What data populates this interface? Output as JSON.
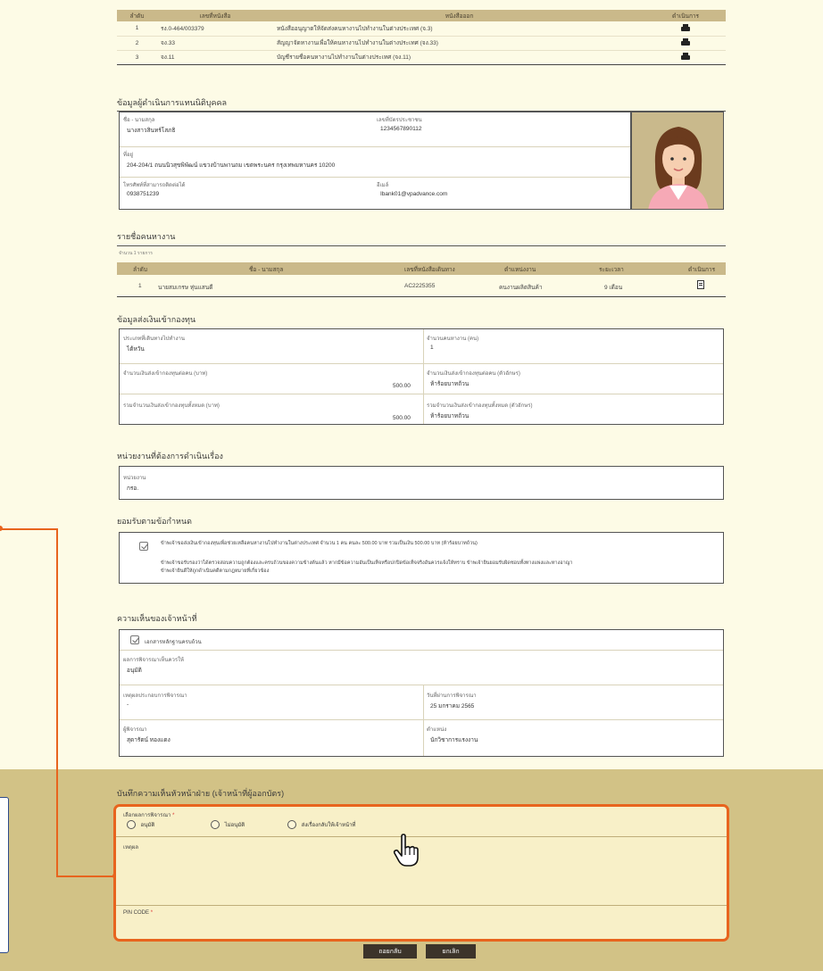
{
  "doc_table": {
    "headers": [
      "ลำดับ",
      "เลขที่หนังสือ",
      "หนังสือออก",
      "ดำเนินการ"
    ],
    "rows": [
      {
        "no": "1",
        "doc_no": "รง.0-464/003379",
        "title": "หนังสืออนุญาตให้จัดส่งคนหางานไปทำงานในต่างประเทศ (จ.3)"
      },
      {
        "no": "2",
        "doc_no": "จง.33",
        "title": "สัญญาจัดหางานเพื่อให้คนหางานไปทำงานในต่างประเทศ (จง.33)"
      },
      {
        "no": "3",
        "doc_no": "จง.11",
        "title": "บัญชีรายชื่อคนหางานไปทำงานในต่างประเทศ (จง.11)"
      }
    ]
  },
  "operator": {
    "section_title": "ข้อมูลผู้ดำเนินการแทนนิติบุคคล",
    "name_label": "ชื่อ - นามสกุล",
    "name_value": "นางสาวสินทร์โสภธิ",
    "id_label": "เลขที่บัตรประชาชน",
    "id_value": "1234567890112",
    "address_label": "ที่อยู่",
    "address_value": "204-204/1 ถนนนิวสุขพิพัฒน์ แขวงบ้านพานถม เขตพระนคร กรุงเทพมหานคร 10200",
    "phone_label": "โทรศัพท์ที่สามารถติดต่อได้",
    "phone_value": "0938751239",
    "email_label": "อีเมล์",
    "email_value": "Ibank01@vpadvance.com"
  },
  "workers": {
    "section_title": "รายชื่อคนหางาน",
    "count_text": "จำนวน 1 รายการ",
    "headers": [
      "ลำดับ",
      "ชื่อ - นามสกุล",
      "เลขที่หนังสือเดินทาง",
      "ตำแหน่งงาน",
      "ระยะเวลา",
      "ดำเนินการ"
    ],
    "rows": [
      {
        "no": "1",
        "name": "นายสมเกรษ หุ่นแสนดี",
        "passport": "AC2225355",
        "position": "คนงานผลิตสินค้า",
        "duration": "9 เดือน"
      }
    ]
  },
  "fund": {
    "section_title": "ข้อมูลส่งเงินเข้ากองทุน",
    "type_label": "ประเภทที่เดินทางไปทำงาน",
    "type_value": "ไต้หวัน",
    "workers_count_label": "จำนวนคนหางาน (คน)",
    "workers_count_value": "1",
    "per_person_label": "จำนวนเงินส่งเข้ากองทุนต่อคน (บาท)",
    "per_person_value": "500.00",
    "per_person_text_label": "จำนวนเงินส่งเข้ากองทุนต่อคน (ตัวอักษร)",
    "per_person_text_value": "ห้าร้อยบาทถ้วน",
    "total_label": "รวมจำนวนเงินส่งเข้ากองทุนทั้งหมด (บาท)",
    "total_value": "500.00",
    "total_text_label": "รวมจำนวนเงินส่งเข้ากองทุนทั้งหมด (ตัวอักษร)",
    "total_text_value": "ห้าร้อยบาทถ้วน"
  },
  "agency": {
    "section_title": "หน่วยงานที่ต้องการดำเนินเรื่อง",
    "label": "หน่วยงาน",
    "value": "กรอ."
  },
  "terms": {
    "section_title": "ยอมรับตามข้อกำหนด",
    "line1": "ข้าพเจ้าขอส่งเงินเข้ากองทุนเพื่อช่วยเหลือคนหางานไปทำงานในต่างประเทศ จำนวน 1 คน คนละ 500.00 บาท รวมเป็นเงิน 500.00 บาท (ห้าร้อยบาทถ้วน)",
    "line2": "ข้าพเจ้าขอรับรองว่าได้ตรวจสอบความถูกต้องและครบถ้วนของความข้างต้นแล้ว หากมีข้อความอันเป็นเท็จหรือปกปิดข้อเท็จจริงอันควรแจ้งให้ทราบ ข้าพเจ้ายินยอมรับผิดชอบทั้งทางแพ่งและทางอาญา",
    "line3": "ข้าพเจ้ายินดีให้ถูกดำเนินคดีตามกฎหมายที่เกี่ยวข้อง"
  },
  "officer": {
    "section_title": "ความเห็นของเจ้าหน้าที่",
    "checkbox_label": "เอกสารหลักฐานครบถ้วน",
    "result_label": "ผลการพิจารณาเห็นควรให้",
    "result_value": "อนุมัติ",
    "reason_label": "เหตุผลประกอบการพิจารณา",
    "reason_value": "-",
    "date_label": "วันที่ผ่านการพิจารณา",
    "date_value": "25 มกราคม 2565",
    "considerer_label": "ผู้พิจารณา",
    "considerer_value": "สุดารัตน์ ทองแดง",
    "position_label": "ตำแหน่ง",
    "position_value": "นักวิชาการแรงงาน"
  },
  "head_note": {
    "section_title": "บันทึกความเห็นหัวหน้าฝ่าย (เจ้าหน้าที่ผู้ออกบัตร)",
    "select_label": "เลือกผลการพิจารณา",
    "required_mark": "*",
    "options": [
      "อนุมัติ",
      "ไม่อนุมัติ",
      "ส่งเรื่องกลับให้เจ้าหน้าที่"
    ],
    "reason_label": "เหตุผล",
    "pin_label": "PIN CODE",
    "back_button": "ถอยกลับ",
    "cancel_button": "ยกเลิก"
  },
  "colors": {
    "accent": "#e8641e",
    "header_bg": "#cab98a",
    "bottom_bg": "#d2c286",
    "page_bg": "#fdfbe6"
  }
}
